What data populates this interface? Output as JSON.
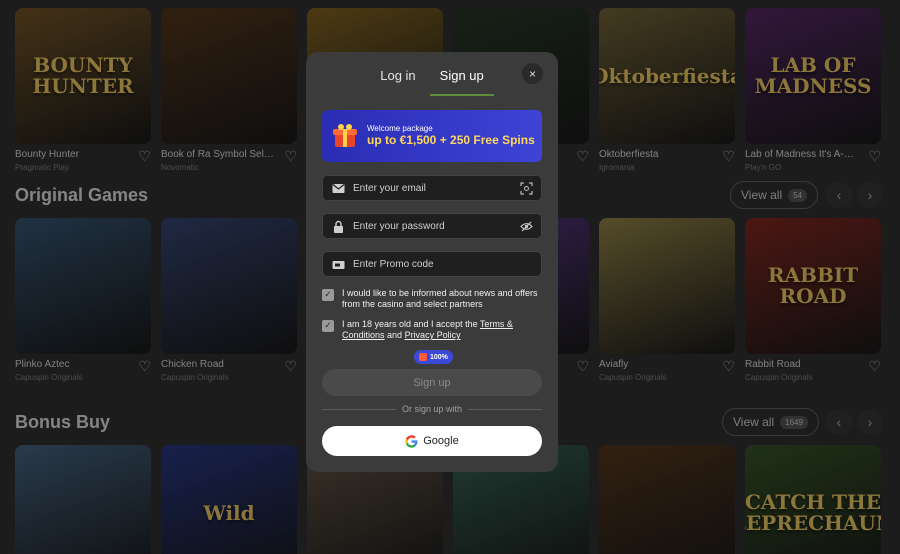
{
  "games_row1": [
    {
      "name": "Bounty Hunter",
      "provider": "Pragmatic Play",
      "art": "BOUNTY HUNTER",
      "color": "#7a5a2a"
    },
    {
      "name": "Book of Ra Symbol Selec...",
      "provider": "Novomatic",
      "art": "",
      "color": "#5a3a1e"
    },
    {
      "name": "",
      "provider": "",
      "art": "",
      "color": "#8a6a22"
    },
    {
      "name": "",
      "provider": "",
      "art": "",
      "color": "#2a3a2a"
    },
    {
      "name": "Oktoberfiesta",
      "provider": "Igromania",
      "art": "Oktoberfiesta",
      "color": "#7a6a3a"
    },
    {
      "name": "Lab of Madness It's A-Wi...",
      "provider": "Play'n GO",
      "art": "LAB OF MADNESS",
      "color": "#5a2a6a"
    }
  ],
  "section_original": {
    "title": "Original Games",
    "view_all": "View all",
    "count": "54"
  },
  "games_row2": [
    {
      "name": "Plinko Aztec",
      "provider": "Capuspin Originals",
      "art": "",
      "color": "#3a5a7a"
    },
    {
      "name": "Chicken Road",
      "provider": "Capuspin Originals",
      "art": "",
      "color": "#3a4a7a"
    },
    {
      "name": "",
      "provider": "",
      "art": "",
      "color": "#3a3a3a"
    },
    {
      "name": "",
      "provider": "",
      "art": "",
      "color": "#5a3a8a"
    },
    {
      "name": "Aviafly",
      "provider": "Capuspin Originals",
      "art": "",
      "color": "#9a8a4a"
    },
    {
      "name": "Rabbit Road",
      "provider": "Capuspin Originals",
      "art": "RABBIT ROAD",
      "color": "#8a2a22"
    }
  ],
  "section_bonus": {
    "title": "Bonus Buy",
    "view_all": "View all",
    "count": "1649"
  },
  "games_row3": [
    {
      "art": "",
      "color": "#4a6a8a"
    },
    {
      "art": "Wild",
      "color": "#2a3a8a"
    },
    {
      "art": "",
      "color": "#6a5a4a"
    },
    {
      "art": "",
      "color": "#3a6a5a"
    },
    {
      "art": "",
      "color": "#5a3a1e"
    },
    {
      "art": "CATCH THE LEPRECHAUN",
      "color": "#3a5a2a"
    }
  ],
  "modal": {
    "tab_login": "Log in",
    "tab_signup": "Sign up",
    "close": "×",
    "banner_small": "Welcome package",
    "banner_big": "up to €1,500 + 250 Free Spins",
    "email_placeholder": "Enter your email",
    "password_placeholder": "Enter your password",
    "promo_placeholder": "Enter Promo code",
    "consent_news": "I would like to be informed about news and offers from the casino and select partners",
    "consent_age_prefix": "I am 18 years old and I accept the ",
    "terms_link": "Terms & Conditions",
    "and": " and ",
    "privacy_link": "Privacy Policy",
    "progress": "100%",
    "signup_button": "Sign up",
    "or_text": "Or sign up with",
    "google_button": "Google"
  }
}
